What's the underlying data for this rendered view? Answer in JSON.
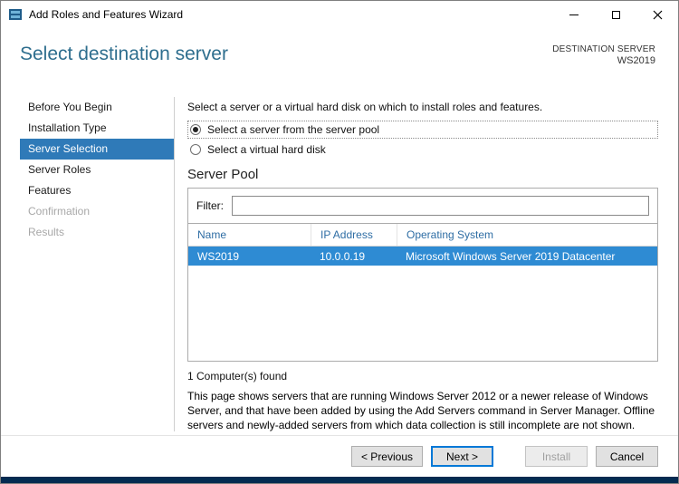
{
  "window": {
    "title": "Add Roles and Features Wizard"
  },
  "header": {
    "title": "Select destination server",
    "destination_label": "DESTINATION SERVER",
    "destination_value": "WS2019"
  },
  "sidebar": {
    "items": [
      {
        "label": "Before You Begin",
        "state": "enabled"
      },
      {
        "label": "Installation Type",
        "state": "enabled"
      },
      {
        "label": "Server Selection",
        "state": "selected"
      },
      {
        "label": "Server Roles",
        "state": "enabled"
      },
      {
        "label": "Features",
        "state": "enabled"
      },
      {
        "label": "Confirmation",
        "state": "disabled"
      },
      {
        "label": "Results",
        "state": "disabled"
      }
    ]
  },
  "main": {
    "intro": "Select a server or a virtual hard disk on which to install roles and features.",
    "radios": [
      {
        "label": "Select a server from the server pool",
        "checked": true
      },
      {
        "label": "Select a virtual hard disk",
        "checked": false
      }
    ],
    "server_pool": {
      "title": "Server Pool",
      "filter_label": "Filter:",
      "filter_value": "",
      "table": {
        "columns": [
          "Name",
          "IP Address",
          "Operating System"
        ],
        "rows": [
          {
            "name": "WS2019",
            "ip": "10.0.0.19",
            "os": "Microsoft Windows Server 2019 Datacenter",
            "selected": true
          }
        ]
      },
      "count_text": "1 Computer(s) found"
    },
    "description": "This page shows servers that are running Windows Server 2012 or a newer release of Windows Server, and that have been added by using the Add Servers command in Server Manager. Offline servers and newly-added servers from which data collection is still incomplete are not shown."
  },
  "footer": {
    "buttons": [
      {
        "label": "< Previous",
        "state": "enabled"
      },
      {
        "label": "Next >",
        "state": "default"
      },
      {
        "label": "Install",
        "state": "disabled"
      },
      {
        "label": "Cancel",
        "state": "enabled"
      }
    ]
  },
  "colors": {
    "accent_nav": "#2f7ab8",
    "row_selected": "#2e8bd3",
    "heading": "#2e6e8e",
    "bottom_strip": "#032b51"
  }
}
